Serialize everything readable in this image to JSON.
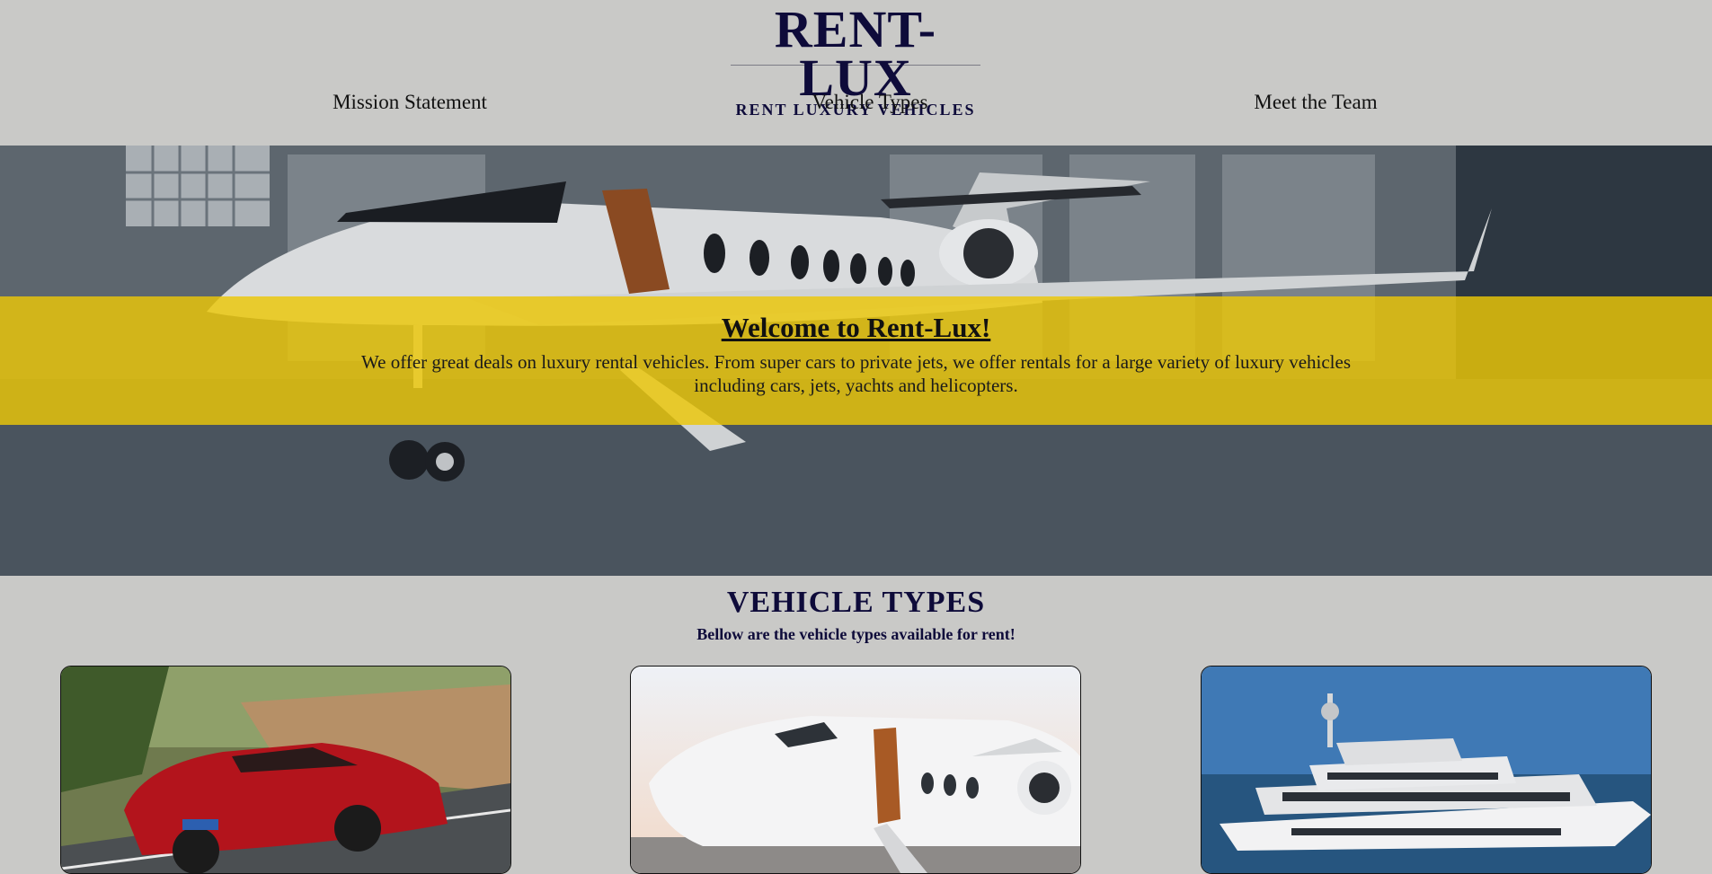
{
  "header": {
    "logo_main": "RENT-LUX",
    "logo_sub": "RENT LUXURY VEHICLES",
    "nav": [
      {
        "label": "Mission Statement"
      },
      {
        "label": "Vehicle Types"
      },
      {
        "label": "Meet the Team"
      }
    ]
  },
  "hero": {
    "title": "Welcome to Rent-Lux!",
    "text": "We offer great deals on luxury rental vehicles. From super cars to private jets, we offer rentals for a large variety of luxury vehicles including cars, jets, yachts and helicopters.",
    "banner_color": "#ECC707"
  },
  "vehicle_types": {
    "title": "VEHICLE TYPES",
    "subtitle": "Bellow are the vehicle types available for rent!",
    "cards": [
      {
        "image": "red-sports-car-photo"
      },
      {
        "image": "private-jet-photo"
      },
      {
        "image": "luxury-yacht-photo"
      }
    ]
  },
  "colors": {
    "background": "#C9C9C7",
    "brand_navy": "#0E0B3A"
  }
}
